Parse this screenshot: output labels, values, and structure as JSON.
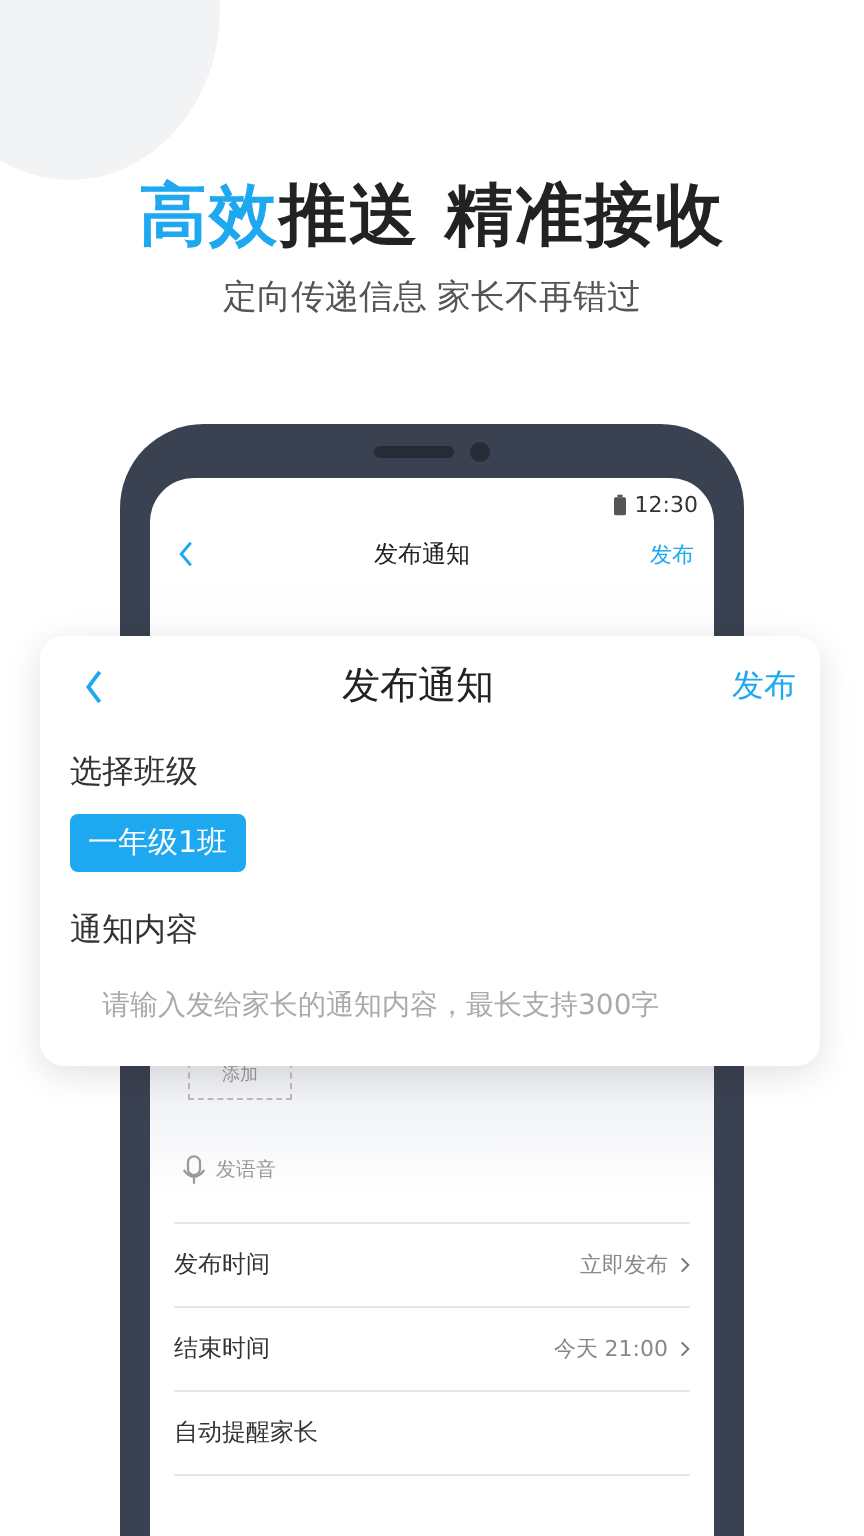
{
  "headline": {
    "accent": "高效",
    "rest": "推送 精准接收"
  },
  "subtitle": "定向传递信息 家长不再错过",
  "phone": {
    "status_time": "12:30",
    "nav": {
      "title": "发布通知",
      "action": "发布"
    },
    "attachment": {
      "label": "添加"
    },
    "voice": {
      "label": "发语音"
    },
    "settings": [
      {
        "label": "发布时间",
        "value": "立即发布"
      },
      {
        "label": "结束时间",
        "value": "今天 21:00"
      },
      {
        "label": "自动提醒家长"
      }
    ]
  },
  "card": {
    "title": "发布通知",
    "action": "发布",
    "class_section": {
      "label": "选择班级",
      "classes": [
        {
          "name": "一年级1班",
          "selected": true
        }
      ]
    },
    "content_section": {
      "label": "通知内容",
      "placeholder": "请输入发给家长的通知内容，最长支持300字"
    }
  }
}
